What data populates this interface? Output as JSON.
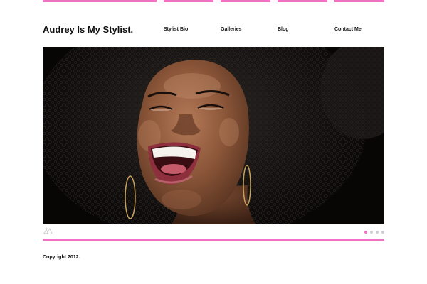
{
  "site": {
    "title": "Audrey Is My Stylist."
  },
  "nav": {
    "items": [
      {
        "label": "Stylist Bio"
      },
      {
        "label": "Galleries"
      },
      {
        "label": "Blog"
      },
      {
        "label": "Contact Me"
      }
    ]
  },
  "slider": {
    "image": "smiling-woman-portrait",
    "slide_count": 4,
    "active_slide": 1
  },
  "footer": {
    "copyright": "Copyright 2012."
  },
  "colors": {
    "accent": "#f072c5",
    "dot_inactive": "#cfcfd6",
    "hero_background": "#070605"
  }
}
